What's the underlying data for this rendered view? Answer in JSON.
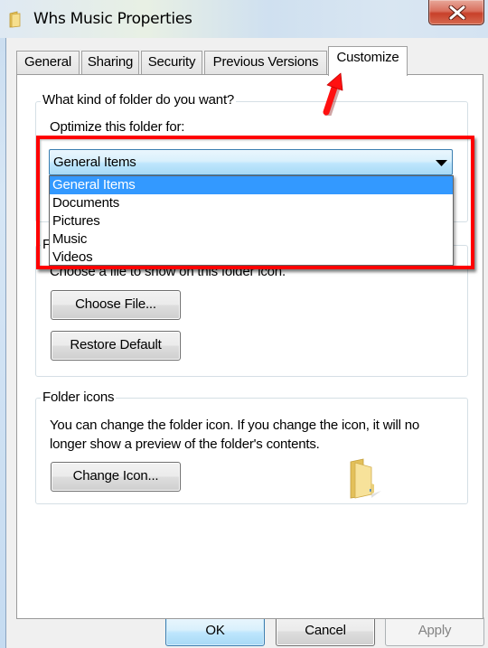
{
  "window": {
    "title": "Whs Music Properties",
    "close_icon": "close-icon"
  },
  "tabs": [
    {
      "label": "General",
      "active": false
    },
    {
      "label": "Sharing",
      "active": false
    },
    {
      "label": "Security",
      "active": false
    },
    {
      "label": "Previous Versions",
      "active": false
    },
    {
      "label": "Customize",
      "active": true
    }
  ],
  "folder_type": {
    "group_label": "What kind of folder do you want?",
    "optimize_label": "Optimize this folder for:",
    "selected": "General Items",
    "options": [
      "General Items",
      "Documents",
      "Pictures",
      "Music",
      "Videos"
    ],
    "highlighted_option": "General Items"
  },
  "folder_pictures": {
    "group_label_partial": "F",
    "description": "Choose a file to show on this folder icon.",
    "choose_file_label": "Choose File...",
    "restore_default_label": "Restore Default"
  },
  "folder_icons": {
    "group_label": "Folder icons",
    "description_line1": "You can change the folder icon. If you change the icon, it will no",
    "description_line2": "longer show a preview of the folder's contents.",
    "change_icon_label": "Change Icon...",
    "preview_icon": "folder-icon"
  },
  "footer": {
    "ok_label": "OK",
    "cancel_label": "Cancel",
    "apply_label": "Apply",
    "apply_enabled": false
  },
  "annotations": {
    "highlight_color": "#ff0000",
    "arrow_color": "#ff0000"
  },
  "colors": {
    "selection": "#3399ff",
    "combo_border": "#3c7fb1",
    "dialog_bg": "#f0f0f0"
  }
}
